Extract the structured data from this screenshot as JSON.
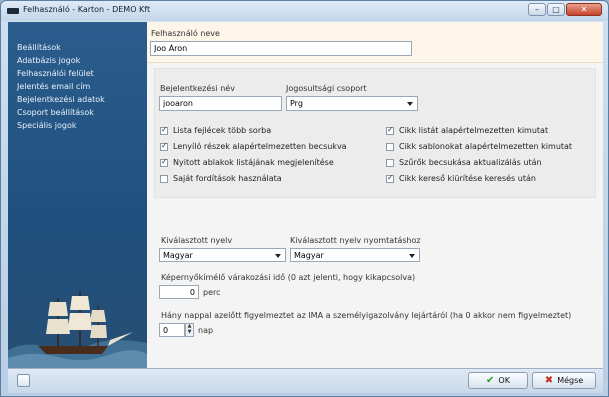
{
  "window": {
    "title": "Felhasználó - Karton  - DEMO Kft"
  },
  "sidebar": {
    "items": [
      {
        "label": "Beállítások"
      },
      {
        "label": "Adatbázis jogok"
      },
      {
        "label": "Felhasználói felület"
      },
      {
        "label": "Jelentés email cím"
      },
      {
        "label": "Bejelentkezési adatok"
      },
      {
        "label": "Csoport beállítások"
      },
      {
        "label": "Speciális jogok"
      }
    ]
  },
  "form": {
    "user_name_label": "Felhasználó neve",
    "user_name_value": "Joo Áron",
    "login_label": "Bejelentkezési név",
    "login_value": "jooaron",
    "group_label": "Jogosultsági csoport",
    "group_value": "Prg",
    "checkboxes_left": [
      {
        "label": "Lista fejlécek több sorba",
        "checked": true
      },
      {
        "label": "Lenyíló részek alapértelmezetten becsukva",
        "checked": true
      },
      {
        "label": "Nyitott ablakok listájának megjelenítése",
        "checked": true
      },
      {
        "label": "Saját fordítások használata",
        "checked": false
      }
    ],
    "checkboxes_right": [
      {
        "label": "Cikk listát alapértelmezetten kimutat",
        "checked": true
      },
      {
        "label": "Cikk sablonokat alapértelmezetten kimutat",
        "checked": false
      },
      {
        "label": "Szűrők becsukása aktualizálás után",
        "checked": false
      },
      {
        "label": "Cikk kereső kiürítése keresés után",
        "checked": true
      }
    ],
    "language_label": "Kiválasztott nyelv",
    "language_value": "Magyar",
    "print_language_label": "Kiválasztott nyelv nyomtatáshoz",
    "print_language_value": "Magyar",
    "screensaver_label": "Képernyőkímélő várakozási idő (0 azt jelenti, hogy kikapcsolva)",
    "screensaver_value": "0",
    "screensaver_unit": "perc",
    "warning_label": "Hány nappal azelőtt figyelmeztet az IMA a személyigazolvány lejártáról (ha 0 akkor nem figyelmeztet)",
    "warning_value": "0",
    "warning_unit": "nap"
  },
  "buttons": {
    "ok": "OK",
    "cancel": "Mégse"
  }
}
